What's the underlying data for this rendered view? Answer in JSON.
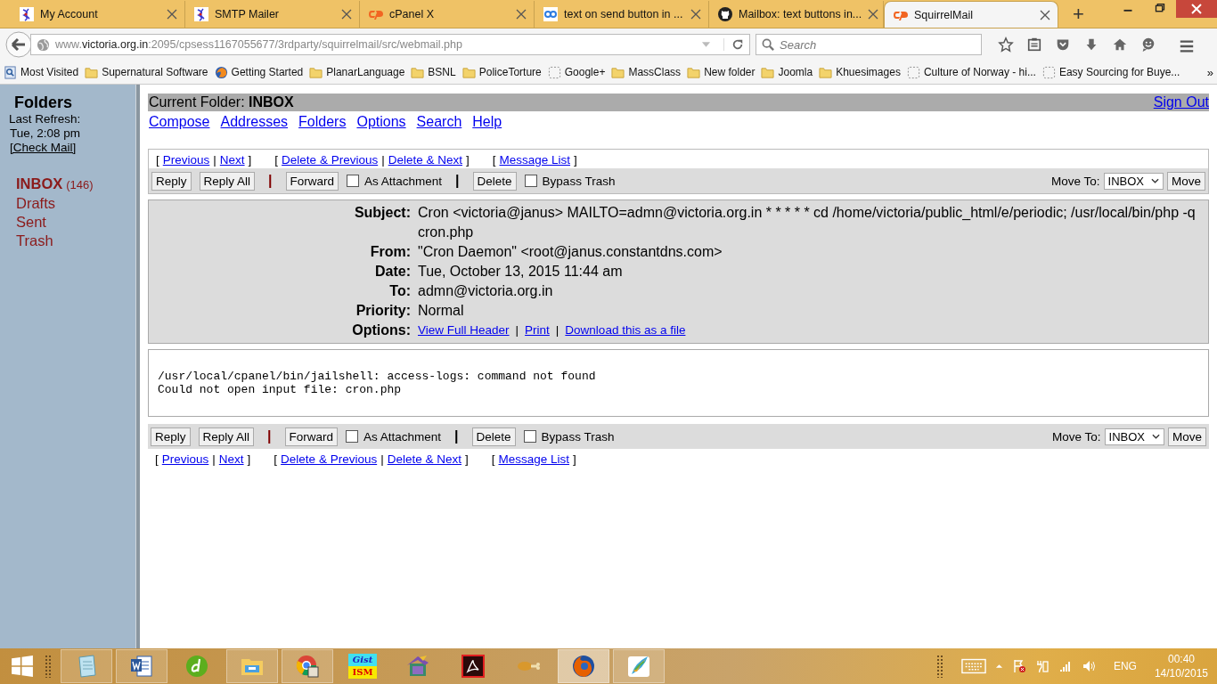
{
  "browser": {
    "tabs": [
      {
        "title": "My Account",
        "kind": "knot",
        "selected": false
      },
      {
        "title": "SMTP Mailer",
        "kind": "knot",
        "selected": false
      },
      {
        "title": "cPanel X",
        "kind": "cpanel",
        "selected": false
      },
      {
        "title": "text on send button in ...",
        "kind": "loop",
        "selected": false
      },
      {
        "title": "Mailbox: text buttons in...",
        "kind": "github",
        "selected": false
      },
      {
        "title": "SquirrelMail",
        "kind": "cpanel",
        "selected": true
      }
    ],
    "new_tab": "+",
    "address": {
      "prefix": "www.",
      "host": "victoria.org.in",
      "rest": ":2095/cpsess1167055677/3rdparty/squirrelmail/src/webmail.php"
    },
    "search": {
      "placeholder": "Search"
    },
    "bookmarks": [
      {
        "label": "Most Visited",
        "kind": "most-visited"
      },
      {
        "label": "Supernatural Software",
        "kind": "folder"
      },
      {
        "label": "Getting Started",
        "kind": "globe"
      },
      {
        "label": "PlanarLanguage",
        "kind": "folder"
      },
      {
        "label": "BSNL",
        "kind": "folder"
      },
      {
        "label": "PoliceTorture",
        "kind": "folder"
      },
      {
        "label": "Google+",
        "kind": "blank"
      },
      {
        "label": "MassClass",
        "kind": "folder"
      },
      {
        "label": "New folder",
        "kind": "folder"
      },
      {
        "label": "Joomla",
        "kind": "folder"
      },
      {
        "label": "Khuesimages",
        "kind": "folder"
      },
      {
        "label": "Culture of Norway - hi...",
        "kind": "blank"
      },
      {
        "label": "Easy Sourcing for Buye...",
        "kind": "blank"
      }
    ],
    "bookmarks_overflow": "»"
  },
  "sidebar": {
    "title": "Folders",
    "refresh_label": "Last Refresh:",
    "refresh_time": "Tue, 2:08 pm",
    "check_mail": "[Check Mail]",
    "folders": [
      {
        "name": "INBOX",
        "count": "(146)",
        "selected": true
      },
      {
        "name": "Drafts",
        "selected": false
      },
      {
        "name": "Sent",
        "selected": false
      },
      {
        "name": "Trash",
        "selected": false
      }
    ]
  },
  "main": {
    "current_folder_label": "Current Folder:",
    "current_folder": "INBOX",
    "sign_out": "Sign Out",
    "menu": [
      "Compose",
      "Addresses",
      "Folders",
      "Options",
      "Search",
      "Help"
    ],
    "navs": [
      [
        {
          "open": "[",
          "links": [
            "Previous",
            "Next"
          ],
          "sep": "|",
          "close": "]"
        },
        {
          "open": "[",
          "links": [
            "Delete & Previous",
            "Delete & Next"
          ],
          "sep": "|",
          "close": "]"
        },
        {
          "open": "[",
          "links": [
            "Message List"
          ],
          "close": "]"
        }
      ],
      [
        {
          "open": "[",
          "links": [
            "Previous",
            "Next"
          ],
          "sep": "|",
          "close": "]"
        },
        {
          "open": "[",
          "links": [
            "Delete & Previous",
            "Delete & Next"
          ],
          "sep": "|",
          "close": "]"
        },
        {
          "open": "[",
          "links": [
            "Message List"
          ],
          "close": "]"
        }
      ]
    ],
    "toolbars": [
      {
        "items": [
          {
            "kind": "button",
            "label": "Reply"
          },
          {
            "kind": "button",
            "label": "Reply All"
          },
          {
            "kind": "separator",
            "label": "|",
            "color": "#800000"
          },
          {
            "kind": "button",
            "label": "Forward"
          },
          {
            "kind": "checkbox",
            "label": "As Attachment",
            "checked": false
          },
          {
            "kind": "separator",
            "label": "|",
            "color": "#000000"
          },
          {
            "kind": "button",
            "label": "Delete"
          },
          {
            "kind": "checkbox",
            "label": "Bypass Trash",
            "checked": false
          }
        ],
        "move_label": "Move To:",
        "move_select": "INBOX",
        "move_button": "Move"
      },
      {
        "items": [
          {
            "kind": "button",
            "label": "Reply"
          },
          {
            "kind": "button",
            "label": "Reply All"
          },
          {
            "kind": "separator",
            "label": "|",
            "color": "#800000"
          },
          {
            "kind": "button",
            "label": "Forward"
          },
          {
            "kind": "checkbox",
            "label": "As Attachment",
            "checked": false
          },
          {
            "kind": "separator",
            "label": "|",
            "color": "#000000"
          },
          {
            "kind": "button",
            "label": "Delete"
          },
          {
            "kind": "checkbox",
            "label": "Bypass Trash",
            "checked": false
          }
        ],
        "move_label": "Move To:",
        "move_select": "INBOX",
        "move_button": "Move"
      }
    ],
    "headers": [
      {
        "label": "Subject:",
        "value": "Cron <victoria@janus> MAILTO=admn@victoria.org.in * * * * * cd /home/victoria/public_html/e/periodic; /usr/local/bin/php -q cron.php"
      },
      {
        "label": "From:",
        "value": "\"Cron Daemon\" <root@janus.constantdns.com>"
      },
      {
        "label": "Date:",
        "value": "Tue, October 13, 2015 11:44 am"
      },
      {
        "label": "To:",
        "value": "admn@victoria.org.in"
      },
      {
        "label": "Priority:",
        "value": "Normal"
      },
      {
        "label": "Options:",
        "links": [
          "View Full Header",
          "Print",
          "Download this as a file"
        ],
        "sep": "|"
      }
    ],
    "body": [
      "/usr/local/cpanel/bin/jailshell: access-logs: command not found",
      "Could not open input file: cron.php"
    ]
  },
  "taskbar": {
    "items": [
      {
        "kind": "notepad",
        "running": true,
        "selected": false
      },
      {
        "kind": "word",
        "running": true,
        "selected": false
      },
      {
        "kind": "dreamweaver",
        "running": false,
        "selected": false
      },
      {
        "kind": "explorer",
        "running": true,
        "selected": false
      },
      {
        "kind": "chrome",
        "running": true,
        "selected": false
      },
      {
        "kind": "gist",
        "running": false,
        "selected": false,
        "top": "Gist",
        "bottom": "ISM"
      },
      {
        "kind": "house",
        "running": false,
        "selected": false
      },
      {
        "kind": "acrobat",
        "running": false,
        "selected": false
      },
      {
        "kind": "drumstick",
        "running": false,
        "selected": false
      },
      {
        "kind": "firefox",
        "running": true,
        "selected": true
      },
      {
        "kind": "paint",
        "running": true,
        "selected": false
      }
    ],
    "lang": "ENG",
    "time": "00:40",
    "date": "14/10/2015"
  }
}
